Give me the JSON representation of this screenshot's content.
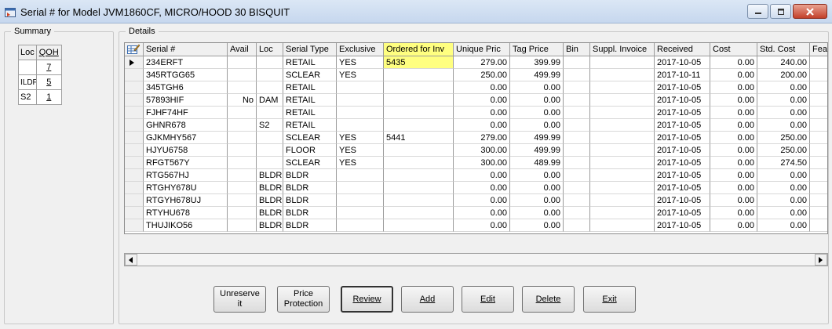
{
  "window": {
    "title": "Serial # for Model JVM1860CF, MICRO/HOOD 30 BISQUIT"
  },
  "summary": {
    "legend": "Summary",
    "headers": [
      "Loc",
      "QOH"
    ],
    "rows": [
      {
        "loc": "",
        "qoh": "7"
      },
      {
        "loc": "ILDF",
        "qoh": "5"
      },
      {
        "loc": "S2",
        "qoh": "1"
      }
    ]
  },
  "details": {
    "legend": "Details",
    "columns": [
      "Serial #",
      "Avail",
      "Loc",
      "Serial Type",
      "Exclusive",
      "Ordered for Inv",
      "Unique Pric",
      "Tag Price",
      "Bin",
      "Suppl. Invoice",
      "Received",
      "Cost",
      "Std. Cost",
      "Featu"
    ],
    "rows": [
      [
        "234ERFT",
        "",
        "",
        "RETAIL",
        "YES",
        "5435",
        "279.00",
        "399.99",
        "",
        "",
        "2017-10-05",
        "0.00",
        "240.00",
        ""
      ],
      [
        "345RTGG65",
        "",
        "",
        "SCLEAR",
        "YES",
        "",
        "250.00",
        "499.99",
        "",
        "",
        "2017-10-11",
        "0.00",
        "200.00",
        ""
      ],
      [
        "345TGH6",
        "",
        "",
        "RETAIL",
        "",
        "",
        "0.00",
        "0.00",
        "",
        "",
        "2017-10-05",
        "0.00",
        "0.00",
        ""
      ],
      [
        "57893HIF",
        "No",
        "DAM",
        "RETAIL",
        "",
        "",
        "0.00",
        "0.00",
        "",
        "",
        "2017-10-05",
        "0.00",
        "0.00",
        ""
      ],
      [
        "FJHF74HF",
        "",
        "",
        "RETAIL",
        "",
        "",
        "0.00",
        "0.00",
        "",
        "",
        "2017-10-05",
        "0.00",
        "0.00",
        ""
      ],
      [
        "GHNR678",
        "",
        "S2",
        "RETAIL",
        "",
        "",
        "0.00",
        "0.00",
        "",
        "",
        "2017-10-05",
        "0.00",
        "0.00",
        ""
      ],
      [
        "GJKMHY567",
        "",
        "",
        "SCLEAR",
        "YES",
        "5441",
        "279.00",
        "499.99",
        "",
        "",
        "2017-10-05",
        "0.00",
        "250.00",
        ""
      ],
      [
        "HJYU6758",
        "",
        "",
        "FLOOR",
        "YES",
        "",
        "300.00",
        "499.99",
        "",
        "",
        "2017-10-05",
        "0.00",
        "250.00",
        ""
      ],
      [
        "RFGT567Y",
        "",
        "",
        "SCLEAR",
        "YES",
        "",
        "300.00",
        "489.99",
        "",
        "",
        "2017-10-05",
        "0.00",
        "274.50",
        ""
      ],
      [
        "RTG567HJ",
        "",
        "BLDR",
        "BLDR",
        "",
        "",
        "0.00",
        "0.00",
        "",
        "",
        "2017-10-05",
        "0.00",
        "0.00",
        ""
      ],
      [
        "RTGHY678U",
        "",
        "BLDR",
        "BLDR",
        "",
        "",
        "0.00",
        "0.00",
        "",
        "",
        "2017-10-05",
        "0.00",
        "0.00",
        ""
      ],
      [
        "RTGYH678UJ",
        "",
        "BLDR",
        "BLDR",
        "",
        "",
        "0.00",
        "0.00",
        "",
        "",
        "2017-10-05",
        "0.00",
        "0.00",
        ""
      ],
      [
        "RTYHU678",
        "",
        "BLDR",
        "BLDR",
        "",
        "",
        "0.00",
        "0.00",
        "",
        "",
        "2017-10-05",
        "0.00",
        "0.00",
        ""
      ],
      [
        "THUJIKO56",
        "",
        "BLDR",
        "BLDR",
        "",
        "",
        "0.00",
        "0.00",
        "",
        "",
        "2017-10-05",
        "0.00",
        "0.00",
        ""
      ]
    ],
    "highlight_column": "Ordered for Inv",
    "highlight_color": "#ffff80"
  },
  "buttons": {
    "unreserve_line1": "Unreserve",
    "unreserve_line2": "it",
    "price_line1": "Price",
    "price_line2": "Protection",
    "review": "Review",
    "add": "Add",
    "edit": "Edit",
    "delete": "Delete",
    "exit": "Exit"
  },
  "icons": {
    "app": "app-window-icon",
    "edit_grid": "edit-grid-icon",
    "row_pointer": "row-pointer-icon"
  }
}
